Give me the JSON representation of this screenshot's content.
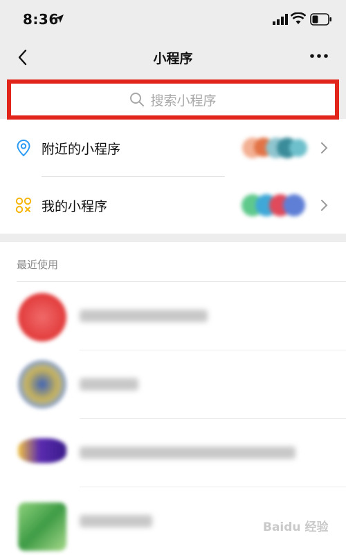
{
  "status_bar": {
    "time": "8:36"
  },
  "nav": {
    "title": "小程序"
  },
  "search": {
    "placeholder": "搜索小程序"
  },
  "entries": [
    {
      "label": "附近的小程序",
      "icon": "location-pin-icon"
    },
    {
      "label": "我的小程序",
      "icon": "grid-circles-icon"
    }
  ],
  "recent": {
    "title": "最近使用"
  },
  "colors": {
    "accent_red": "#e1251b",
    "icon_blue": "#2b9bf4",
    "icon_yellow": "#f5b50a",
    "bg_gray": "#ededed"
  },
  "watermark": {
    "text": "Baidu 经验"
  }
}
